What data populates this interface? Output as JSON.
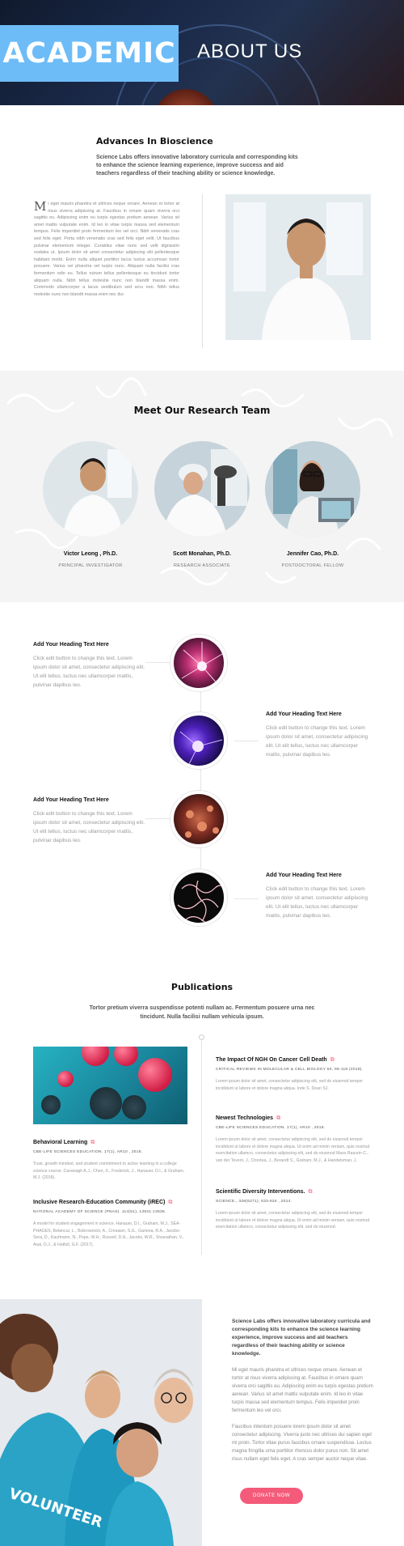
{
  "hero": {
    "badge": "ACADEMIC",
    "title": "ABOUT US"
  },
  "intro": {
    "heading": "Advances In Bioscience",
    "lead": "Science Labs offers innovative laboratory curricula and corresponding kits to enhance the science learning experience, improve success and aid teachers regardless of their teaching ability or science knowledge.",
    "dropcap": "M",
    "body": "i eget mauris pharetra et ultrices neque ornare. Aenean et tortor at risus viverra adipiscing at. Faucibus in ornare quam viverra orci sagittis eu. Adipiscing enim eu turpis egestas pretium aenean. Varius sit amet mattis vulputate enim. Id leo in vitae turpis massa sed elementum tempus. Felis imperdiet proin fermentum leo vel orci. Nibh venenatis cras sed felis eget. Porta nibh venenatis cras sed felis eget velit. Ut faucibus pulvinar elementum integer. Curabitur vitae nunc sed velit dignissim sodales ut. Ipsum dolor sit amet consectetur adipiscing elit pellentesque habitant morbi. Enim nulla aliquet porttitor lacus luctus accumsan tortor posuere. Varius vel pharetra vel turpis nunc. Aliquam nulla facilisi cras fermentum odio eu. Tellus rutrum tellus pellentesque eu tincidunt tortor aliquam nulla. Nibh tellus molestie nunc non blandit massa enim. Commodo ullamcorper a lacus vestibulum sed arcu non. Nibh tellus molestie nunc non blandit massa enim nec dui."
  },
  "team": {
    "heading": "Meet Our Research Team",
    "members": [
      {
        "name": "Victor Leong , Ph.D.",
        "role": "PRINCIPAL INVESTIGATOR"
      },
      {
        "name": "Scott Monahan, Ph.D.",
        "role": "RESEARCH ASSOCIATE"
      },
      {
        "name": "Jennifer Cao, Ph.D.",
        "role": "POSTDOCTORAL FELLOW"
      }
    ]
  },
  "timeline": [
    {
      "heading": "Add Your Heading Text Here",
      "text": "Click edit button to change this text. Lorem ipsum dolor sit amet, consectetur adipiscing elit. Ut elit tellus, luctus nec ullamcorper mattis, pulvinar dapibus leo."
    },
    {
      "heading": "Add Your Heading Text Here",
      "text": "Click edit button to change this text. Lorem ipsum dolor sit amet, consectetur adipiscing elit. Ut elit tellus, luctus nec ullamcorper mattis, pulvinar dapibus leo."
    },
    {
      "heading": "Add Your Heading Text Here",
      "text": "Click edit button to change this text. Lorem ipsum dolor sit amet, consectetur adipiscing elit. Ut elit tellus, luctus nec ullamcorper mattis, pulvinar dapibus leo."
    },
    {
      "heading": "Add Your Heading Text Here",
      "text": "Click edit button to change this text. Lorem ipsum dolor sit amet, consectetur adipiscing elit. Ut elit tellus, luctus nec ullamcorper mattis, pulvinar dapibus leo."
    }
  ],
  "publications": {
    "heading": "Publications",
    "subtitle": "Tortor pretium viverra suspendisse potenti nullam ac. Fermentum posuere urna nec tincidunt. Nulla facilisi nullam vehicula ipsum.",
    "left": [
      {
        "title": "Behavioral Learning",
        "source": "CBE-LIFE SCIENCES EDUCATION. 17(1), AR10 , 2018.",
        "desc": "Trust, growth mindset, and student commitment to active learning in a college science course. Cavanagh A.J., Chen, X., Frederick, J., Hanauer, D.I., & Graham, M.J. (2018)."
      },
      {
        "title": "Inclusive Research-Education Community (iREC)",
        "source": "NATIONAL ACADEMY OF SCIENCE (PNAS). 114(51), 13531-13536.",
        "desc": "A model for student engagement in science. Hanauer, D.I., Graham, M.J., SEA-PHAGES, Betancur, L., Bobrownicki, A., Cresawn, S.G., Garlena, R.A., Jacobs-Sera, D., Kaufmann, N., Pope, W.H., Russell, D.A., Jacobs, W.R., Sivanathan, V., Asai, D.J., & Hatfull, G.F. (2017)."
      }
    ],
    "right": [
      {
        "title": "The Impact Of NGH On Cancer Cell Death",
        "source": "CRITICAL REVIEWS IN MOLECULAR & CELL BIOLOGY 50, 98-118 (2018).",
        "desc": "Lorem ipsum dolor sit amet, consectetur adipiscing elit, sed do eiusmod tempor incididunt ut labore et dolore magna aliqua. Inde S. Dean SJ."
      },
      {
        "title": "Newest Technologies",
        "source": "CBE-LIFE SCIENCES EDUCATION. 17(1), AR10 , 2018.",
        "desc": "Lorem ipsum dolor sit amet, consectetur adipiscing elit, sed do eiusmod tempor incididunt ut labore et dolore magna aliqua. Ut enim ad minim veniam, quis nostrud exercitation ullamco, consectetur adipiscing elit, sed do eiusmod Mass Rasurin C., van der Tevern, J., Dorotea, J., Berandt S., Graham, M.J., & Handelsman, J."
      },
      {
        "title": "Scientific Diversity Interventions.",
        "source": "SCIENCE., 348(6271), 633-634 , 2014.",
        "desc": "Lorem ipsum dolor sit amet, consectetur adipiscing elit, sed do eiusmod tempor incididunt ut labore et dolore magna aliqua. Ut enim ad minim veniam, quis nostrud exercitation ullamco, consectetur adipiscing elit, sed do eiusmod."
      }
    ]
  },
  "cta": {
    "lead": "Science Labs offers innovative laboratory curricula and corresponding kits to enhance the science learning experience, improve success and aid teachers regardless of their teaching ability or science knowledge.",
    "p1": "Mi eget mauris pharetra et ultrices neque ornare. Aenean et tortor at risus viverra adipiscing at. Faucibus in ornare quam viverra orci sagittis eu. Adipiscing enim eu turpis egestas pretium aenean. Varius sit amet mattis vulputate enim. Id leo in vitae turpis massa sed elementum tempus. Felis imperdiet proin fermentum leo vel orci.",
    "p2": "Faucibus interdum posuere lorem ipsum dolor sit amet consectetur adipiscing. Viverra justo nec ultrices dui sapien eget mi proin. Tortor vitae purus faucibus ornare suspendisse. Lectus magna fringilla urna porttitor rhoncus dolor purus non. Sit amet risus nullam eget felis eget. A cras semper auctor neque vitae.",
    "button": "DONATE NOW",
    "shirt_text": "VOLUNTEER"
  },
  "colors": {
    "accent": "#6dbcf7",
    "button": "#f45b7a"
  },
  "icons": {
    "external_link": "external-link-icon"
  }
}
